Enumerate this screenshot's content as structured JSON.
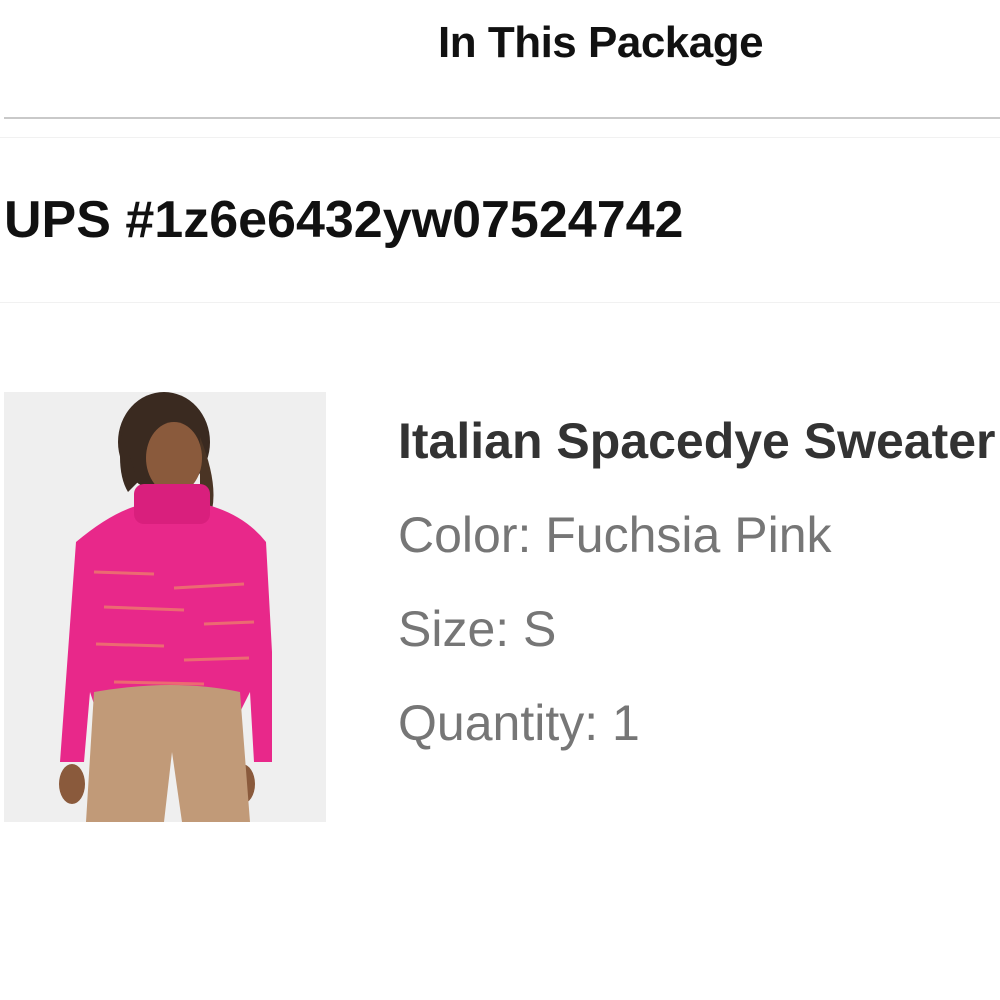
{
  "header": {
    "title": "In This Package"
  },
  "shipment": {
    "tracking": "UPS #1z6e6432yw07524742"
  },
  "item": {
    "image_alt": "Model wearing pink turtleneck sweater",
    "name": "Italian Spacedye Sweater",
    "color": "Color: Fuchsia Pink",
    "size": "Size: S",
    "quantity": "Quantity: 1"
  },
  "colors": {
    "sweater": "#e8288a",
    "pants": "#c19a78",
    "image_bg": "#efefef",
    "divider": "#c9c9c9"
  }
}
